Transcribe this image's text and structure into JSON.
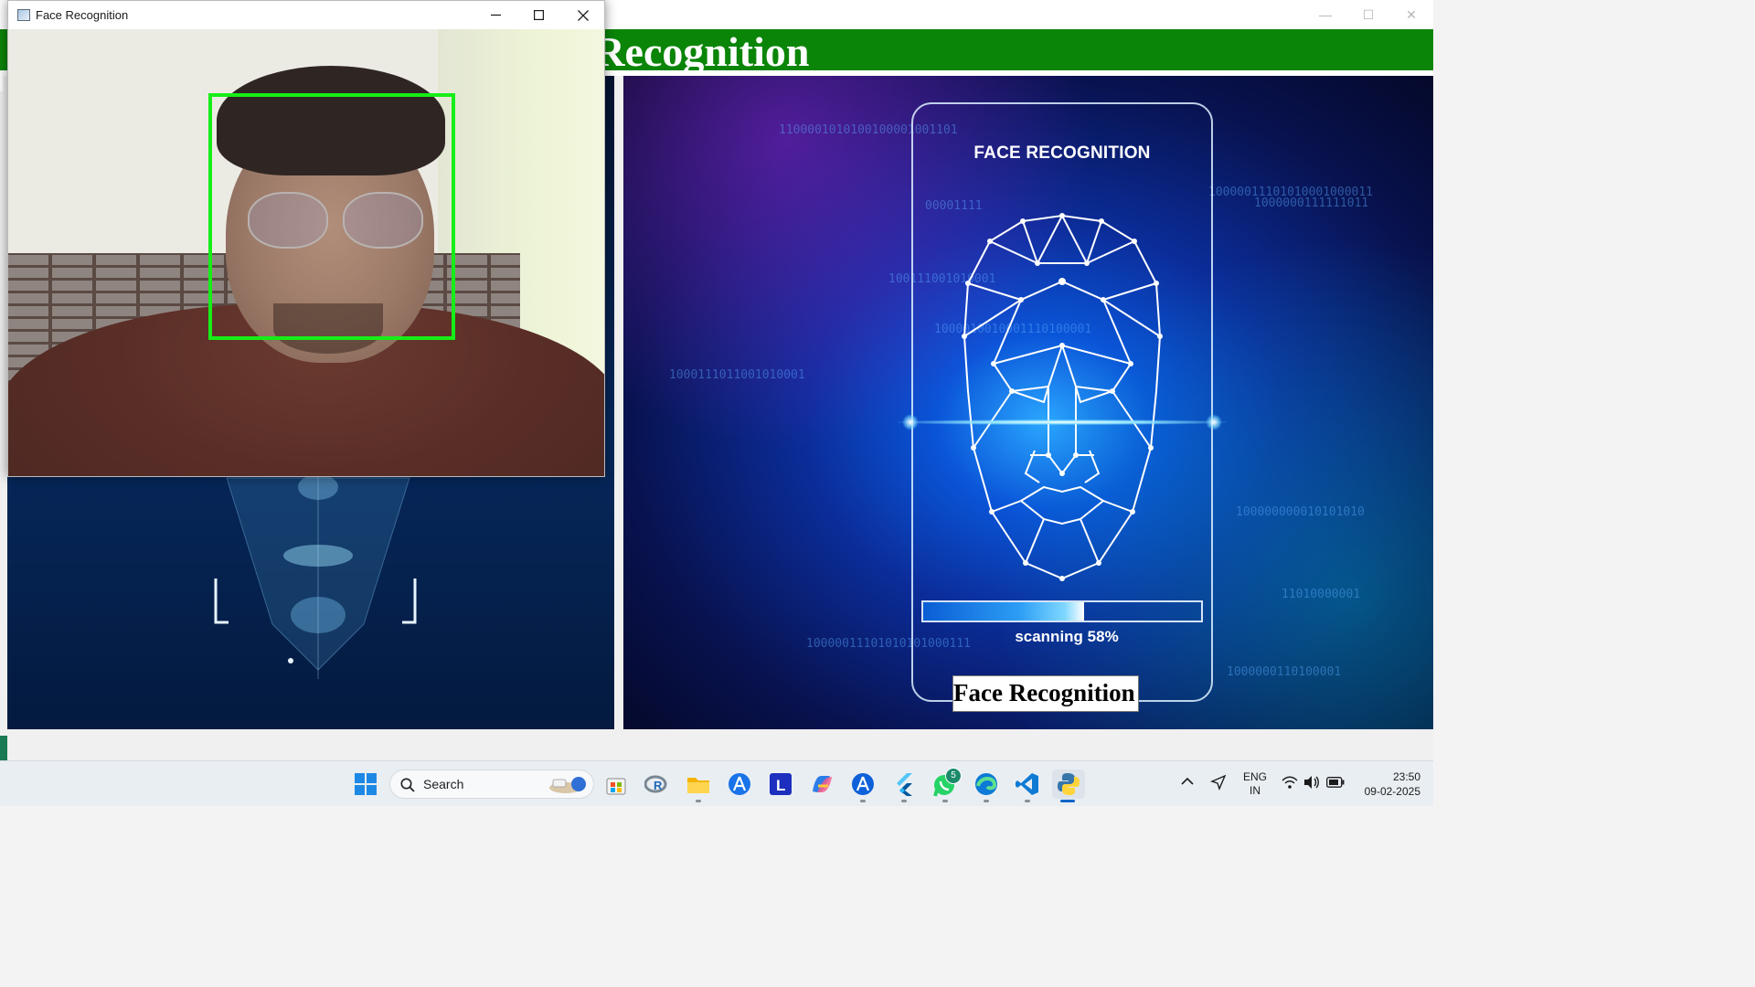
{
  "background_window": {
    "banner_text": "ce Recognition",
    "card_title": "FACE RECOGNITION",
    "scan_progress_pct": 58,
    "scan_label": "scanning 58%",
    "label_text": "Face Recognition",
    "binary_lines": [
      "1100001010100100001001101",
      "10000011101010001000011",
      "00001111",
      "1000000111111011",
      "100111001010001",
      "1000010010001110100001",
      "100000000010101010",
      "11010000001",
      "10000011101010101000111",
      "1000000110100001",
      "1000111011001010001"
    ],
    "window_controls": [
      "minimize",
      "maximize",
      "close"
    ]
  },
  "camera_window": {
    "title": "Face Recognition",
    "controls": [
      "minimize",
      "maximize",
      "close"
    ],
    "detection_box_color": "#17ee17"
  },
  "taskbar": {
    "search_label": "Search",
    "pinned_icons": [
      "windows-start",
      "search",
      "microsoft-store",
      "r-studio",
      "file-explorer",
      "app-installer",
      "l-app",
      "copilot",
      "app-store",
      "flutter",
      "whatsapp",
      "edge",
      "vscode",
      "python"
    ],
    "whatsapp_badge": "5",
    "language_line1": "ENG",
    "language_line2": "IN",
    "time": "23:50",
    "date": "09-02-2025"
  }
}
